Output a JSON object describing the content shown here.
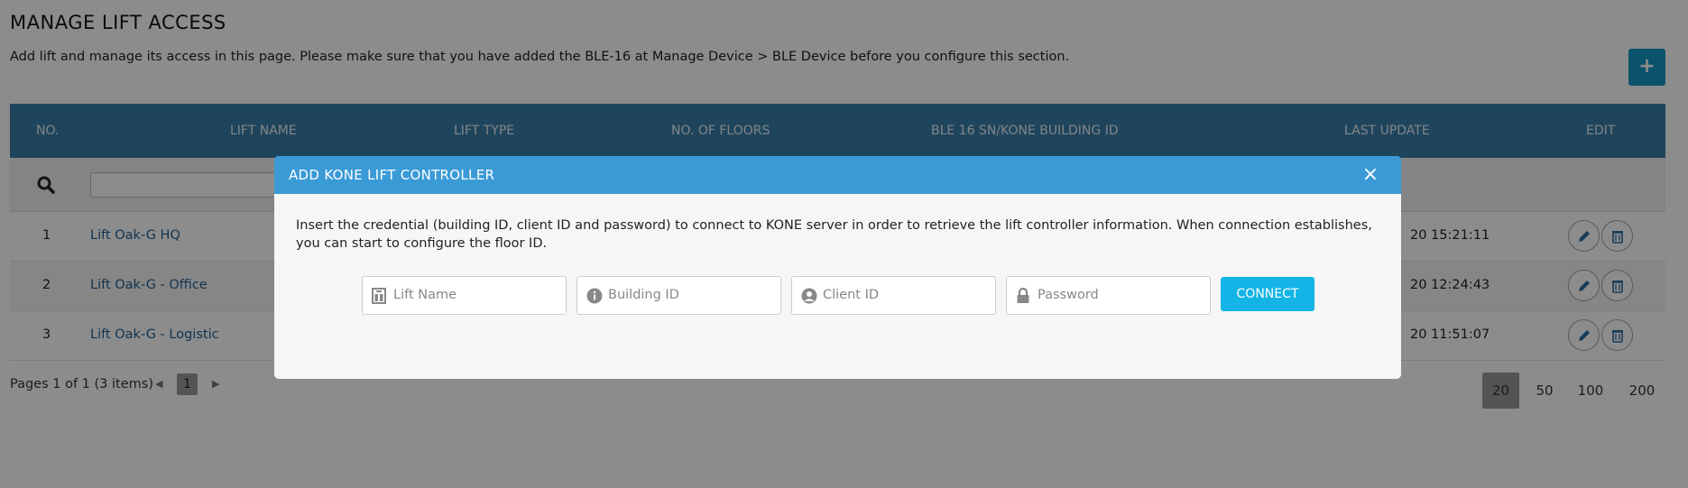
{
  "page": {
    "title": "MANAGE LIFT ACCESS",
    "description": "Add lift and manage its access in this page. Please make sure that you have added the BLE-16 at Manage Device > BLE Device before you configure this section.",
    "add_button": "+"
  },
  "table": {
    "columns": [
      "NO.",
      "LIFT NAME",
      "LIFT TYPE",
      "NO. OF FLOORS",
      "BLE 16 SN/KONE BUILDING ID",
      "LAST UPDATE",
      "EDIT"
    ],
    "rows": [
      {
        "no": "1",
        "name": "Lift Oak-G HQ",
        "last_update": "20 15:21:11"
      },
      {
        "no": "2",
        "name": "Lift Oak-G - Office",
        "last_update": "20 12:24:43"
      },
      {
        "no": "3",
        "name": "Lift Oak-G - Logistic",
        "last_update": "20 11:51:07"
      }
    ]
  },
  "pager": {
    "summary": "Pages 1 of 1 (3 items)",
    "prev": "◀",
    "current_page": "1",
    "next": "▶",
    "page_sizes": [
      "20",
      "50",
      "100",
      "200"
    ],
    "active_page_size": "20"
  },
  "modal": {
    "title": "ADD KONE LIFT CONTROLLER",
    "close": "×",
    "instructions": "Insert the credential (building ID, client ID and password) to connect to KONE server in order to retrieve the lift controller information. When connection establishes, you can start to configure the floor ID.",
    "fields": {
      "lift_name": {
        "placeholder": "Lift Name",
        "icon": "lift-icon",
        "value": ""
      },
      "building_id": {
        "placeholder": "Building ID",
        "icon": "info-icon",
        "value": ""
      },
      "client_id": {
        "placeholder": "Client ID",
        "icon": "user-icon",
        "value": ""
      },
      "password": {
        "placeholder": "Password",
        "icon": "lock-icon",
        "value": ""
      }
    },
    "connect_button": "CONNECT"
  },
  "colors": {
    "header": "#3a7fa9",
    "modal_header": "#3a9ad6",
    "connect": "#14b4e6",
    "add_button": "#1596c2",
    "link": "#1f5f93"
  }
}
